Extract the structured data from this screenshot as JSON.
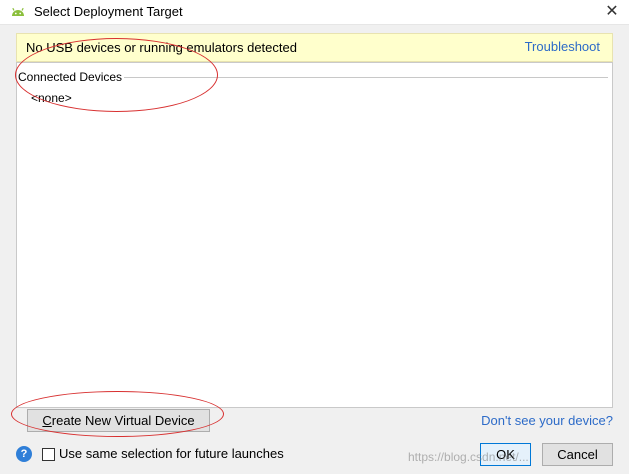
{
  "window": {
    "title": "Select Deployment Target",
    "close_glyph": "✕",
    "icon": "android-icon"
  },
  "banner": {
    "message": "No USB devices or running emulators detected",
    "link": "Troubleshoot"
  },
  "devices": {
    "section_label": "Connected Devices",
    "empty_text": "<none>"
  },
  "actions": {
    "create_first_letter": "C",
    "create_rest": "reate New Virtual Device",
    "dont_see": "Don't see your device?",
    "help_glyph": "?",
    "checkbox_label": "Use same selection for future launches",
    "checkbox_checked": false,
    "ok": "OK",
    "cancel": "Cancel"
  },
  "watermark": "https://blog.csdn.net/...",
  "colors": {
    "banner_bg": "#ffffcc",
    "link": "#2d6bc8",
    "annotation": "#d83030"
  }
}
